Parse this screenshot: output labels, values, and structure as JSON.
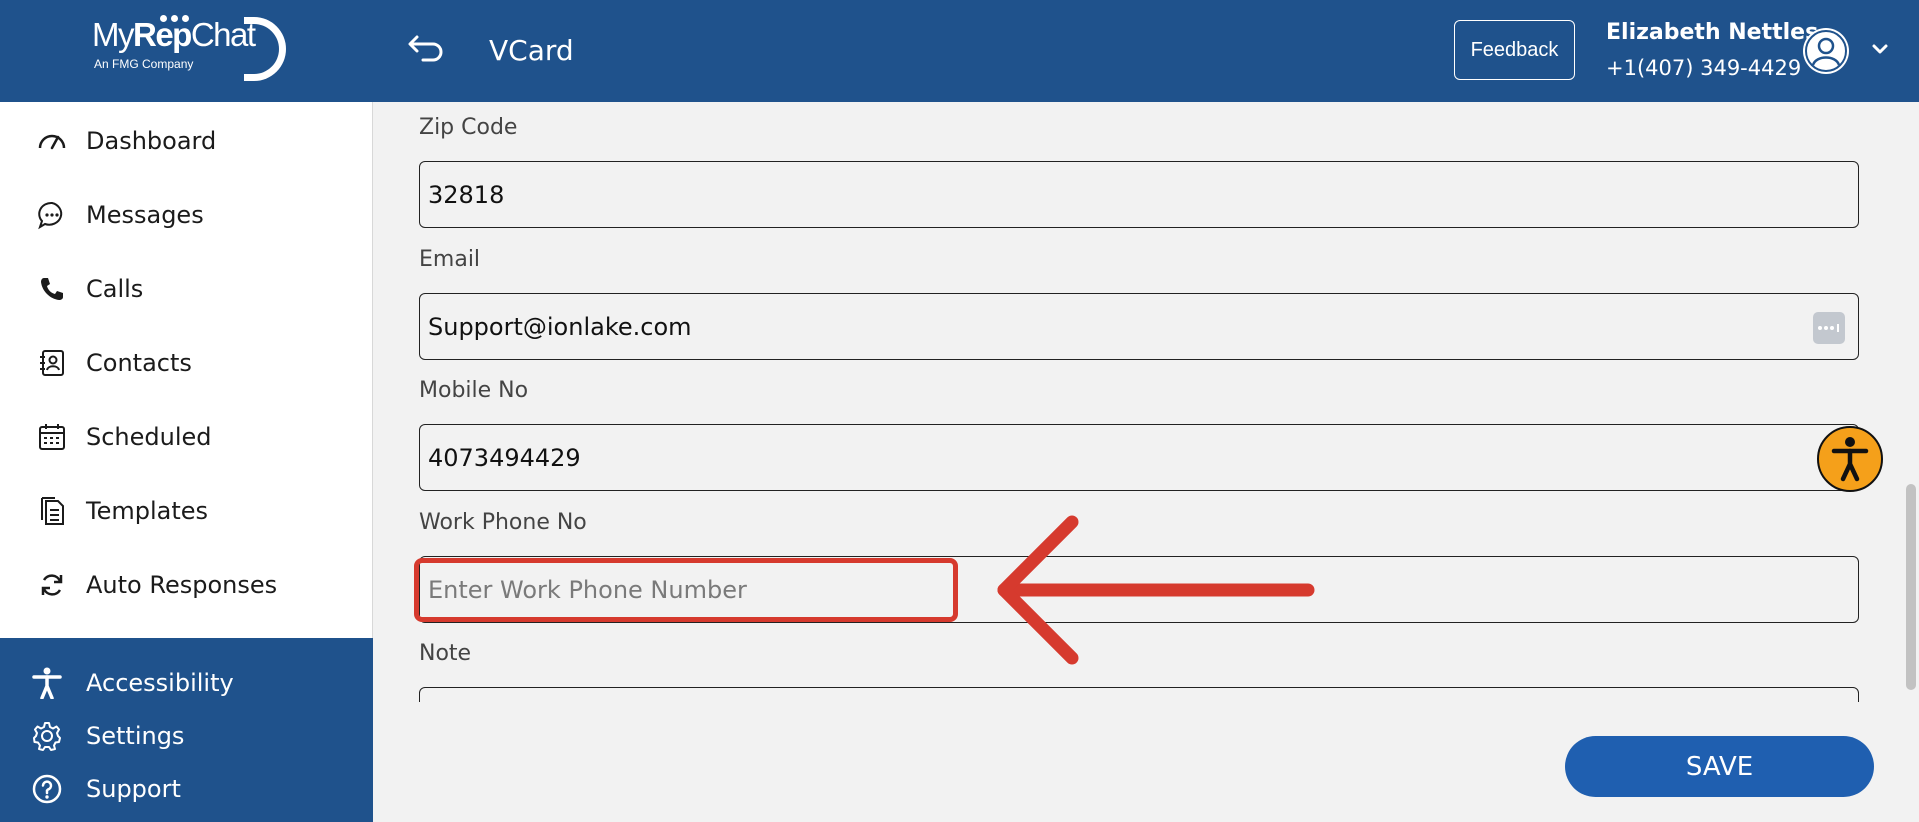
{
  "app": {
    "logo_text_1": "My",
    "logo_text_2": "Rep",
    "logo_text_3": "Chat",
    "logo_subtitle": "An FMG Company"
  },
  "sidebar": {
    "items": [
      {
        "label": "Dashboard",
        "icon": "dashboard-gauge-icon"
      },
      {
        "label": "Messages",
        "icon": "chat-bubble-icon"
      },
      {
        "label": "Calls",
        "icon": "phone-icon"
      },
      {
        "label": "Contacts",
        "icon": "contact-card-icon"
      },
      {
        "label": "Scheduled",
        "icon": "calendar-icon"
      },
      {
        "label": "Templates",
        "icon": "document-icon"
      },
      {
        "label": "Auto Responses",
        "icon": "refresh-icon"
      }
    ],
    "bottom_items": [
      {
        "label": "Accessibility",
        "icon": "accessibility-icon"
      },
      {
        "label": "Settings",
        "icon": "gear-icon"
      },
      {
        "label": "Support",
        "icon": "help-icon"
      }
    ]
  },
  "header": {
    "title": "VCard",
    "feedback_label": "Feedback",
    "user_name": "Elizabeth Nettles",
    "user_phone": "+1(407) 349-4429"
  },
  "form": {
    "fields": [
      {
        "label": "Zip Code",
        "value": "32818",
        "placeholder": ""
      },
      {
        "label": "Email",
        "value": "Support@ionlake.com",
        "placeholder": ""
      },
      {
        "label": "Mobile No",
        "value": "4073494429",
        "placeholder": ""
      },
      {
        "label": "Work Phone No",
        "value": "",
        "placeholder": "Enter Work Phone Number"
      },
      {
        "label": "Note",
        "value": "",
        "placeholder": ""
      }
    ],
    "save_label": "SAVE"
  },
  "colors": {
    "brand": "#1f528c",
    "save_button": "#1f5fb0",
    "annotation": "#d63a2e",
    "accessibility_badge": "#f5a01a"
  }
}
